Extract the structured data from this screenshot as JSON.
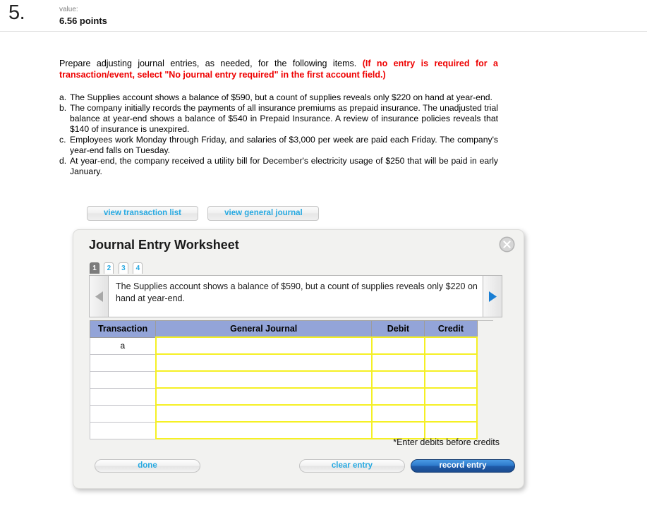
{
  "header": {
    "question_number": "5.",
    "value_label": "value:",
    "points": "6.56 points"
  },
  "question": {
    "instruction_plain": "Prepare adjusting journal entries, as needed, for the following items.",
    "instruction_emphasis": "(If no entry is required for a transaction/event, select \"No journal entry required\" in the first account field.)",
    "items": [
      {
        "marker": "a.",
        "text": "The Supplies account shows a balance of $590, but a count of supplies reveals only $220 on hand at year-end."
      },
      {
        "marker": "b.",
        "text": "The company initially records the payments of all insurance premiums as prepaid insurance. The unadjusted trial balance at year-end shows a balance of $540 in Prepaid Insurance. A review of insurance policies reveals that $140 of insurance is unexpired."
      },
      {
        "marker": "c.",
        "text": "Employees work Monday through Friday, and salaries of $3,000 per week are paid each Friday. The company's year-end falls on Tuesday."
      },
      {
        "marker": "d.",
        "text": "At year-end, the company received a utility bill for December's electricity usage of $250 that will be paid in early January."
      }
    ]
  },
  "view_tabs": {
    "transaction_list": "view transaction list",
    "general_journal": "view general journal"
  },
  "dialog": {
    "title": "Journal Entry Worksheet",
    "close_icon": "close-circle-icon",
    "step_tabs": [
      {
        "label": "1",
        "active": true
      },
      {
        "label": "2",
        "active": false
      },
      {
        "label": "3",
        "active": false
      },
      {
        "label": "4",
        "active": false
      }
    ],
    "prev_icon": "triangle-left-icon",
    "next_icon": "triangle-right-icon",
    "prompt_text": "The Supplies account shows a balance of $590, but a count of supplies reveals only $220 on hand at year-end.",
    "table": {
      "columns": [
        "Transaction",
        "General Journal",
        "Debit",
        "Credit"
      ],
      "rows": [
        {
          "transaction": "a",
          "general_journal": "",
          "debit": "",
          "credit": ""
        },
        {
          "transaction": "",
          "general_journal": "",
          "debit": "",
          "credit": ""
        },
        {
          "transaction": "",
          "general_journal": "",
          "debit": "",
          "credit": ""
        },
        {
          "transaction": "",
          "general_journal": "",
          "debit": "",
          "credit": ""
        },
        {
          "transaction": "",
          "general_journal": "",
          "debit": "",
          "credit": ""
        },
        {
          "transaction": "",
          "general_journal": "",
          "debit": "",
          "credit": ""
        }
      ]
    },
    "debits_note": "*Enter debits before credits",
    "buttons": {
      "done": "done",
      "clear_entry": "clear entry",
      "record_entry": "record entry"
    }
  },
  "colors": {
    "accent_blue": "#27a9e1",
    "record_button_blue": "#2f7ccc",
    "emphasis_red": "#ee0000",
    "table_header": "#93a4d8",
    "input_border_yellow": "#f5f024"
  }
}
